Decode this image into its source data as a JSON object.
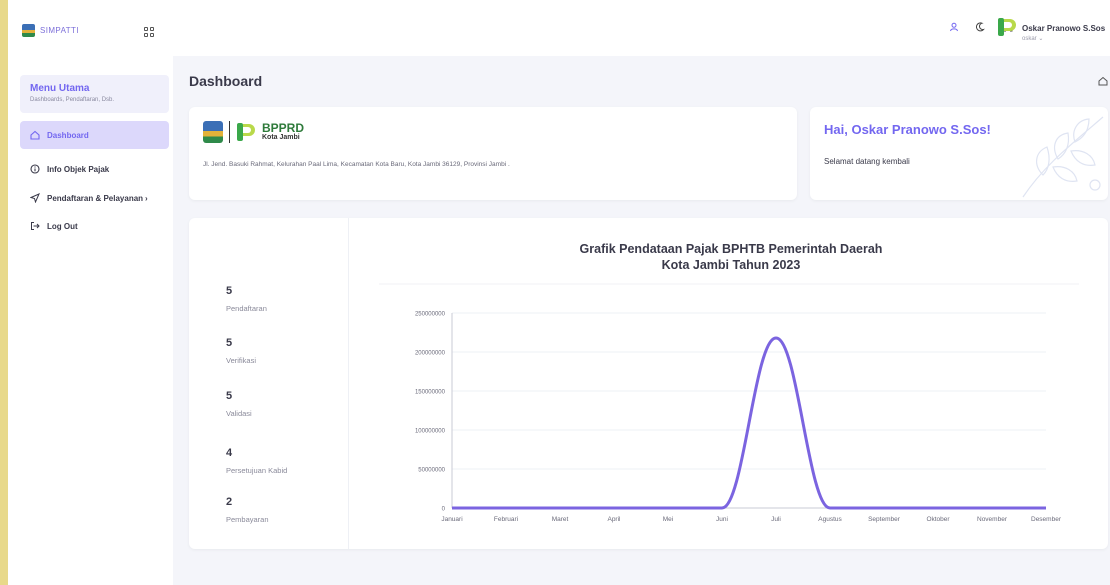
{
  "app": {
    "brand": "SIMPATTI"
  },
  "sidebar": {
    "menu_title": "Menu Utama",
    "menu_subtitle": "Dashboards, Pendaftaran, Dsb.",
    "items": [
      {
        "label": "Dashboard",
        "icon": "home-icon",
        "active": true
      },
      {
        "label": "Info Objek Pajak",
        "icon": "info-icon",
        "active": false
      },
      {
        "label": "Pendaftaran & Pelayanan",
        "icon": "send-icon",
        "active": false
      },
      {
        "label": "Log Out",
        "icon": "logout-icon",
        "active": false
      }
    ]
  },
  "topbar": {
    "user_name": "Oskar Pranowo S.Sos",
    "username": "oskar",
    "icons": [
      "user-icon",
      "moon-icon",
      "fullscreen-icon"
    ]
  },
  "page": {
    "title": "Dashboard"
  },
  "bpprd": {
    "name": "BPPRD",
    "subtitle": "Kota Jambi",
    "address": "Jl. Jend. Basuki Rahmat, Kelurahan Paal Lima, Kecamatan Kota Baru, Kota Jambi 36129, Provinsi Jambi ."
  },
  "welcome": {
    "title": "Hai, Oskar Pranowo S.Sos!",
    "subtitle": "Selamat datang kembali"
  },
  "stats": [
    {
      "value": "5",
      "label": "Pendaftaran"
    },
    {
      "value": "5",
      "label": "Verifikasi"
    },
    {
      "value": "5",
      "label": "Validasi"
    },
    {
      "value": "4",
      "label": "Persetujuan Kabid"
    },
    {
      "value": "2",
      "label": "Pembayaran"
    }
  ],
  "colors": {
    "accent": "#7367f0",
    "line": "#7b64e0"
  },
  "chart_data": {
    "type": "line",
    "title": [
      "Grafik Pendataan Pajak BPHTB Pemerintah Daerah",
      "Kota Jambi Tahun 2023"
    ],
    "categories": [
      "Januari",
      "Februari",
      "Maret",
      "April",
      "Mei",
      "Juni",
      "Juli",
      "Agustus",
      "September",
      "Oktober",
      "November",
      "Desember"
    ],
    "values": [
      0,
      0,
      0,
      0,
      0,
      0,
      218000000,
      0,
      0,
      0,
      0,
      0
    ],
    "ylim": [
      0,
      250000000
    ],
    "yticks": [
      0,
      50000000,
      100000000,
      150000000,
      200000000,
      250000000
    ],
    "smooth": true,
    "grid": true
  }
}
